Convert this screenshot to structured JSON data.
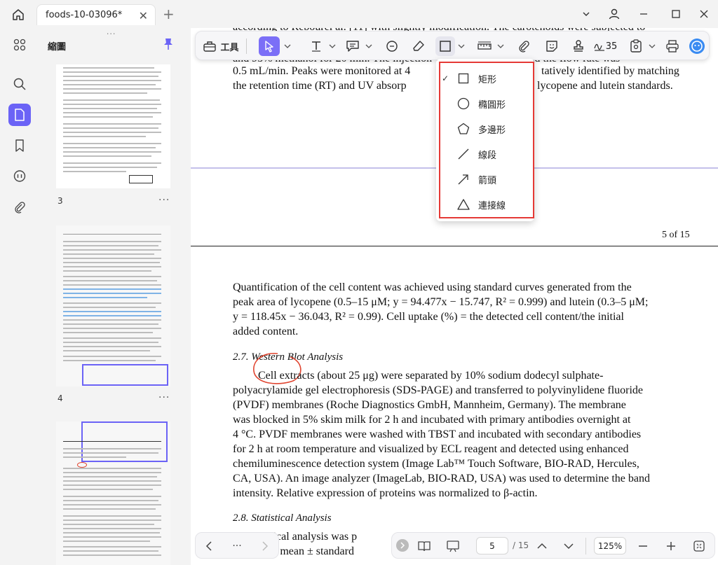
{
  "titlebar": {
    "tab_title": "foods-10-03096*",
    "tab_close": "✕",
    "new_tab": "+"
  },
  "sidebar": {
    "title": "縮圖",
    "pages": [
      {
        "number": "3",
        "more": "···"
      },
      {
        "number": "4",
        "more": "···"
      }
    ]
  },
  "toolbar": {
    "tools_label": "工具",
    "font_size": "35"
  },
  "shape_menu": {
    "items": [
      {
        "label": "矩形",
        "checked": true,
        "icon": "rectangle-icon"
      },
      {
        "label": "橢圓形",
        "checked": false,
        "icon": "ellipse-icon"
      },
      {
        "label": "多邊形",
        "checked": false,
        "icon": "polygon-icon"
      },
      {
        "label": "線段",
        "checked": false,
        "icon": "line-icon"
      },
      {
        "label": "箭頭",
        "checked": false,
        "icon": "arrow-icon"
      },
      {
        "label": "連接線",
        "checked": false,
        "icon": "connector-icon"
      }
    ],
    "check_glyph": "✓"
  },
  "document": {
    "top_lines": [
      "according to Rebourel al. [11] with slightly modification. The carotenoids were subjected to",
      "and 95% methanol for 20 min. The injection volume was 20 μL, and the flow rate was",
      "0.5 mL/min. Peaks were monitored at 4",
      "tatively identified by matching",
      "the retention time (RT) and UV absorp",
      "lycopene and lutein standards."
    ],
    "page_label": "5 of 15",
    "para1": [
      "Quantification of the cell content was achieved using standard curves generated from the",
      "peak area of lycopene (0.5–15 μM; y = 94.477x − 15.747, R² = 0.999) and lutein (0.3–5 μM;",
      "y = 118.45x − 36.043, R² = 0.99). Cell uptake (%) = the detected cell content/the initial",
      "added content."
    ],
    "heading1": "2.7. Western Blot Analysis",
    "para2": [
      "Cell extracts (about 25 μg) were separated by 10% sodium dodecyl sulphate-",
      "polyacrylamide gel electrophoresis (SDS-PAGE) and transferred to polyvinylidene fluoride",
      "(PVDF) membranes (Roche Diagnostics GmbH, Mannheim, Germany). The membrane",
      "was blocked in 5% skim milk for 2 h and incubated with primary antibodies overnight at",
      "4 °C. PVDF membranes were washed with TBST and incubated with secondary antibodies",
      "for 2 h at room temperature and visualized by ECL reagent and detected using enhanced",
      "chemiluminescence detection system (Image Lab™ Touch Software, BIO-RAD, Hercules,",
      "CA, USA). An image analyzer (ImageLab, BIO-RAD, USA) was used to determine the band",
      "intensity. Relative expression of proteins was normalized to β-actin."
    ],
    "heading2": "2.8. Statistical Analysis",
    "para3": [
      "tistical analysis was p",
      "d as mean ± standard"
    ]
  },
  "bottombar": {
    "nav_more": "···",
    "current_page": "5",
    "total_pages": "/ 15",
    "zoom": "125%"
  },
  "colors": {
    "accent": "#6b63f6",
    "highlight_border": "#e53935",
    "annotation_red": "#e0442f"
  }
}
